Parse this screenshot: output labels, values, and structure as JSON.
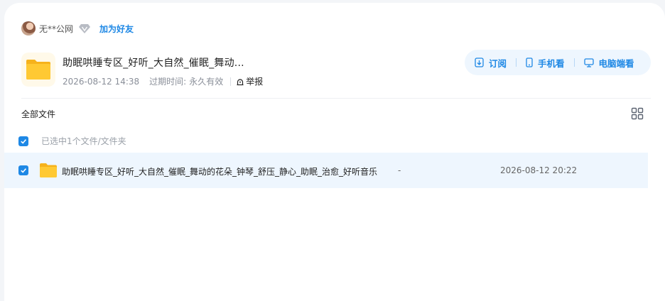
{
  "user": {
    "name": "无**公网",
    "add_friend": "加为好友"
  },
  "share": {
    "title": "助眠哄睡专区_好听_大自然_催眠_舞动...",
    "created": "2026-08-12 14:38",
    "expire_label": "过期时间:",
    "expire_value": "永久有效",
    "report": "举报"
  },
  "actions": {
    "subscribe": "订阅",
    "phone": "手机看",
    "pc": "电脑端看"
  },
  "list": {
    "all_files": "全部文件",
    "selected_text": "已选中1个文件/文件夹",
    "files": [
      {
        "name": "助眠哄睡专区_好听_大自然_催眠_舞动的花朵_钟琴_舒压_静心_助眠_治愈_好听音乐",
        "size": "-",
        "time": "2026-08-12 20:22"
      }
    ]
  },
  "colors": {
    "accent": "#1e88e5",
    "selected_row": "#eef6fe",
    "folder": "#ffc233"
  }
}
